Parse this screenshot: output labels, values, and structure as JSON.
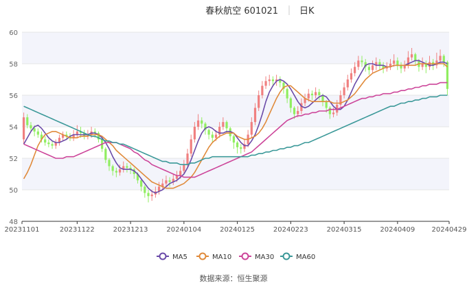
{
  "header": {
    "stock": "春秋航空 601021",
    "period": "日K"
  },
  "source": "数据来源：恒生聚源",
  "colors": {
    "up": "#f08080",
    "down": "#90ee60",
    "ma5": "#6a4aa8",
    "ma10": "#e08a3a",
    "ma30": "#cc4499",
    "ma60": "#3a9898",
    "grid": "#e6e6e6",
    "band": "#f3f4fb"
  },
  "chart_data": {
    "type": "candlestick",
    "ylim": [
      48,
      60
    ],
    "yticks": [
      "60",
      "58",
      "56",
      "54",
      "52",
      "50",
      "48"
    ],
    "xtick_labels": [
      "20231101",
      "20231122",
      "20231213",
      "20240104",
      "20240125",
      "20240223",
      "20240315",
      "20240409",
      "20240429"
    ],
    "xtick_index": [
      0,
      15,
      30,
      45,
      60,
      75,
      90,
      105,
      119
    ],
    "legend": [
      "MA5",
      "MA10",
      "MA30",
      "MA60"
    ],
    "candles": [
      [
        53.2,
        54.6,
        54.9,
        52.9
      ],
      [
        54.6,
        54.1,
        54.8,
        53.9
      ],
      [
        54.1,
        53.9,
        54.3,
        53.7
      ],
      [
        53.9,
        53.7,
        54.1,
        53.4
      ],
      [
        53.7,
        53.5,
        53.9,
        53.3
      ],
      [
        53.5,
        53.2,
        53.7,
        53.0
      ],
      [
        53.2,
        53.0,
        53.4,
        52.8
      ],
      [
        53.0,
        52.9,
        53.2,
        52.7
      ],
      [
        52.9,
        52.8,
        53.1,
        52.6
      ],
      [
        52.8,
        53.0,
        53.2,
        52.6
      ],
      [
        53.0,
        53.3,
        53.5,
        52.8
      ],
      [
        53.3,
        53.5,
        53.7,
        53.1
      ],
      [
        53.5,
        53.4,
        53.7,
        53.2
      ],
      [
        53.4,
        53.3,
        53.6,
        53.1
      ],
      [
        53.3,
        53.5,
        53.8,
        53.1
      ],
      [
        53.5,
        53.7,
        54.1,
        53.3
      ],
      [
        53.7,
        53.6,
        54.0,
        53.3
      ],
      [
        53.6,
        53.4,
        53.8,
        53.2
      ],
      [
        53.4,
        53.5,
        53.8,
        53.2
      ],
      [
        53.5,
        53.7,
        54.0,
        53.3
      ],
      [
        53.7,
        53.6,
        53.9,
        53.3
      ],
      [
        53.6,
        53.2,
        53.7,
        53.0
      ],
      [
        53.2,
        52.6,
        53.3,
        52.4
      ],
      [
        52.6,
        51.9,
        52.7,
        51.7
      ],
      [
        51.9,
        51.5,
        52.0,
        51.2
      ],
      [
        51.5,
        51.2,
        51.6,
        50.9
      ],
      [
        51.2,
        51.1,
        51.4,
        50.8
      ],
      [
        51.1,
        51.3,
        51.6,
        50.9
      ],
      [
        51.3,
        51.5,
        51.8,
        51.1
      ],
      [
        51.5,
        51.4,
        51.7,
        51.1
      ],
      [
        51.4,
        51.3,
        51.6,
        51.0
      ],
      [
        51.3,
        51.0,
        51.4,
        50.7
      ],
      [
        51.0,
        50.6,
        51.1,
        50.4
      ],
      [
        50.6,
        50.2,
        50.7,
        49.9
      ],
      [
        50.2,
        49.8,
        50.3,
        49.5
      ],
      [
        49.8,
        49.6,
        50.0,
        49.2
      ],
      [
        49.6,
        49.7,
        50.0,
        49.3
      ],
      [
        49.7,
        49.9,
        50.2,
        49.5
      ],
      [
        49.9,
        50.2,
        50.5,
        49.7
      ],
      [
        50.2,
        50.4,
        50.7,
        50.0
      ],
      [
        50.4,
        50.6,
        50.9,
        50.2
      ],
      [
        50.6,
        50.5,
        50.8,
        50.2
      ],
      [
        50.5,
        50.7,
        51.0,
        50.3
      ],
      [
        50.7,
        50.9,
        51.2,
        50.5
      ],
      [
        50.9,
        51.2,
        51.5,
        50.7
      ],
      [
        51.2,
        51.6,
        51.9,
        51.0
      ],
      [
        51.6,
        52.3,
        52.6,
        51.4
      ],
      [
        52.3,
        53.2,
        53.5,
        52.1
      ],
      [
        53.2,
        54.0,
        54.3,
        53.0
      ],
      [
        54.0,
        54.4,
        54.8,
        53.8
      ],
      [
        54.4,
        54.2,
        54.6,
        53.9
      ],
      [
        54.2,
        53.8,
        54.3,
        53.5
      ],
      [
        53.8,
        53.5,
        53.9,
        53.2
      ],
      [
        53.5,
        53.3,
        53.7,
        53.0
      ],
      [
        53.3,
        53.5,
        53.8,
        53.1
      ],
      [
        53.5,
        54.0,
        54.3,
        53.3
      ],
      [
        54.0,
        54.3,
        54.6,
        53.8
      ],
      [
        54.3,
        53.9,
        54.4,
        53.6
      ],
      [
        53.9,
        53.4,
        54.0,
        53.1
      ],
      [
        53.4,
        53.0,
        53.5,
        52.6
      ],
      [
        53.0,
        52.7,
        53.1,
        52.3
      ],
      [
        52.7,
        52.6,
        52.9,
        52.3
      ],
      [
        52.6,
        52.9,
        53.2,
        52.4
      ],
      [
        52.9,
        53.5,
        53.8,
        52.7
      ],
      [
        53.5,
        54.3,
        54.6,
        53.3
      ],
      [
        54.3,
        55.2,
        55.5,
        54.1
      ],
      [
        55.2,
        56.0,
        56.3,
        55.0
      ],
      [
        56.0,
        56.6,
        56.9,
        55.8
      ],
      [
        56.6,
        56.9,
        57.2,
        56.4
      ],
      [
        56.9,
        57.0,
        57.3,
        56.6
      ],
      [
        57.0,
        56.9,
        57.2,
        56.6
      ],
      [
        56.9,
        57.0,
        57.3,
        56.6
      ],
      [
        57.0,
        56.8,
        57.2,
        56.5
      ],
      [
        56.8,
        56.4,
        56.9,
        56.1
      ],
      [
        56.4,
        55.8,
        56.5,
        55.5
      ],
      [
        55.8,
        55.2,
        55.9,
        54.9
      ],
      [
        55.2,
        54.8,
        55.3,
        54.5
      ],
      [
        54.8,
        55.0,
        55.3,
        54.6
      ],
      [
        55.0,
        55.5,
        55.8,
        54.8
      ],
      [
        55.5,
        55.8,
        56.1,
        55.3
      ],
      [
        55.8,
        56.1,
        56.4,
        55.6
      ],
      [
        56.1,
        56.0,
        56.3,
        55.7
      ],
      [
        56.0,
        56.2,
        56.5,
        55.8
      ],
      [
        56.2,
        56.0,
        56.4,
        55.7
      ],
      [
        56.0,
        55.6,
        56.1,
        55.3
      ],
      [
        55.6,
        55.2,
        55.7,
        54.9
      ],
      [
        55.2,
        54.8,
        55.3,
        54.5
      ],
      [
        54.8,
        54.9,
        55.2,
        54.6
      ],
      [
        54.9,
        55.4,
        55.7,
        54.7
      ],
      [
        55.4,
        56.0,
        56.3,
        55.2
      ],
      [
        56.0,
        56.5,
        56.8,
        55.8
      ],
      [
        56.5,
        57.0,
        57.3,
        56.3
      ],
      [
        57.0,
        57.4,
        57.7,
        56.8
      ],
      [
        57.4,
        57.8,
        58.1,
        57.2
      ],
      [
        57.8,
        58.2,
        58.5,
        57.6
      ],
      [
        58.2,
        58.1,
        58.5,
        57.8
      ],
      [
        58.1,
        57.8,
        58.3,
        57.5
      ],
      [
        57.8,
        57.6,
        58.0,
        57.3
      ],
      [
        57.6,
        57.9,
        58.2,
        57.4
      ],
      [
        57.9,
        58.1,
        58.4,
        57.6
      ],
      [
        58.1,
        57.9,
        58.3,
        57.6
      ],
      [
        57.9,
        57.7,
        58.1,
        57.4
      ],
      [
        57.7,
        57.8,
        58.1,
        57.5
      ],
      [
        57.8,
        58.0,
        58.3,
        57.6
      ],
      [
        58.0,
        58.2,
        58.6,
        57.8
      ],
      [
        58.2,
        57.9,
        58.4,
        57.6
      ],
      [
        57.9,
        57.7,
        58.1,
        57.4
      ],
      [
        57.7,
        57.9,
        58.2,
        57.5
      ],
      [
        57.9,
        58.4,
        58.8,
        57.7
      ],
      [
        58.4,
        58.6,
        59.0,
        58.2
      ],
      [
        58.6,
        58.2,
        58.7,
        57.9
      ],
      [
        58.2,
        57.8,
        58.3,
        57.5
      ],
      [
        57.8,
        58.0,
        58.4,
        57.6
      ],
      [
        58.0,
        57.8,
        58.2,
        57.4
      ],
      [
        57.8,
        58.1,
        58.5,
        57.6
      ],
      [
        58.1,
        57.9,
        58.3,
        57.6
      ],
      [
        57.9,
        58.2,
        58.7,
        57.7
      ],
      [
        58.2,
        58.5,
        58.9,
        58.0
      ],
      [
        58.5,
        58.1,
        58.6,
        57.8
      ],
      [
        58.1,
        56.4,
        58.2,
        56.0
      ]
    ],
    "series": [
      {
        "name": "MA5",
        "values": [
          52.9,
          53.3,
          53.7,
          54.0,
          54.1,
          53.9,
          53.6,
          53.3,
          53.1,
          53.0,
          53.0,
          53.1,
          53.2,
          53.4,
          53.5,
          53.5,
          53.5,
          53.5,
          53.5,
          53.6,
          53.6,
          53.5,
          53.3,
          53.0,
          52.6,
          52.1,
          51.7,
          51.4,
          51.3,
          51.3,
          51.3,
          51.2,
          51.0,
          50.7,
          50.4,
          50.1,
          49.9,
          49.8,
          49.9,
          50.0,
          50.2,
          50.4,
          50.5,
          50.6,
          50.8,
          51.0,
          51.4,
          51.9,
          52.5,
          53.1,
          53.6,
          53.9,
          54.0,
          53.9,
          53.7,
          53.6,
          53.6,
          53.7,
          53.7,
          53.6,
          53.3,
          53.0,
          52.8,
          52.8,
          53.1,
          53.5,
          54.1,
          54.8,
          55.6,
          56.2,
          56.6,
          56.9,
          57.0,
          56.9,
          56.7,
          56.4,
          56.0,
          55.6,
          55.3,
          55.2,
          55.3,
          55.5,
          55.7,
          55.9,
          56.0,
          55.9,
          55.6,
          55.3,
          55.1,
          55.1,
          55.3,
          55.7,
          56.2,
          56.7,
          57.1,
          57.5,
          57.9,
          58.0,
          58.0,
          57.9,
          57.9,
          57.9,
          57.8,
          57.8,
          57.9,
          57.9,
          57.9,
          57.9,
          58.0,
          58.1,
          58.2,
          58.2,
          58.1,
          58.0,
          57.9,
          57.9,
          58.0,
          58.1,
          58.1,
          58.0
        ]
      },
      {
        "name": "MA10",
        "values": [
          50.7,
          51.1,
          51.6,
          52.2,
          52.8,
          53.2,
          53.5,
          53.6,
          53.7,
          53.7,
          53.6,
          53.5,
          53.4,
          53.3,
          53.3,
          53.3,
          53.4,
          53.4,
          53.4,
          53.5,
          53.5,
          53.5,
          53.4,
          53.2,
          53.0,
          52.8,
          52.5,
          52.3,
          52.1,
          51.9,
          51.7,
          51.5,
          51.3,
          51.1,
          50.9,
          50.7,
          50.5,
          50.4,
          50.3,
          50.2,
          50.1,
          50.1,
          50.1,
          50.2,
          50.3,
          50.4,
          50.6,
          50.8,
          51.1,
          51.5,
          51.9,
          52.3,
          52.7,
          53.0,
          53.2,
          53.4,
          53.5,
          53.6,
          53.6,
          53.6,
          53.4,
          53.3,
          53.2,
          53.2,
          53.3,
          53.4,
          53.6,
          53.9,
          54.3,
          54.8,
          55.3,
          55.8,
          56.2,
          56.5,
          56.6,
          56.6,
          56.4,
          56.2,
          56.0,
          55.8,
          55.7,
          55.6,
          55.6,
          55.6,
          55.6,
          55.6,
          55.6,
          55.5,
          55.5,
          55.5,
          55.6,
          55.7,
          55.9,
          56.1,
          56.4,
          56.7,
          57.0,
          57.2,
          57.4,
          57.5,
          57.6,
          57.7,
          57.8,
          57.8,
          57.9,
          57.9,
          57.9,
          57.9,
          57.9,
          57.9,
          57.9,
          58.0,
          58.0,
          58.0,
          58.0,
          58.0,
          58.0,
          58.0,
          58.0,
          57.8
        ]
      },
      {
        "name": "MA30",
        "values": [
          52.9,
          52.8,
          52.7,
          52.6,
          52.5,
          52.4,
          52.3,
          52.2,
          52.1,
          52.0,
          52.0,
          52.0,
          52.1,
          52.1,
          52.1,
          52.2,
          52.3,
          52.4,
          52.5,
          52.6,
          52.7,
          52.8,
          52.9,
          53.0,
          53.0,
          53.0,
          53.0,
          52.9,
          52.8,
          52.7,
          52.6,
          52.4,
          52.3,
          52.1,
          51.9,
          51.8,
          51.6,
          51.5,
          51.4,
          51.3,
          51.2,
          51.1,
          51.0,
          50.9,
          50.9,
          50.8,
          50.8,
          50.8,
          50.8,
          50.9,
          51.0,
          51.1,
          51.2,
          51.3,
          51.4,
          51.5,
          51.6,
          51.7,
          51.8,
          51.9,
          52.0,
          52.1,
          52.2,
          52.3,
          52.4,
          52.6,
          52.8,
          53.0,
          53.2,
          53.4,
          53.6,
          53.8,
          54.0,
          54.2,
          54.4,
          54.5,
          54.6,
          54.7,
          54.7,
          54.8,
          54.8,
          54.9,
          54.9,
          55.0,
          55.0,
          55.0,
          55.1,
          55.1,
          55.1,
          55.2,
          55.3,
          55.4,
          55.5,
          55.6,
          55.7,
          55.8,
          55.8,
          55.9,
          55.9,
          56.0,
          56.0,
          56.1,
          56.1,
          56.1,
          56.2,
          56.2,
          56.3,
          56.3,
          56.4,
          56.4,
          56.5,
          56.5,
          56.6,
          56.6,
          56.7,
          56.7,
          56.7,
          56.8,
          56.8,
          56.8
        ]
      },
      {
        "name": "MA60",
        "values": [
          55.3,
          55.2,
          55.1,
          55.0,
          54.9,
          54.8,
          54.7,
          54.6,
          54.5,
          54.4,
          54.3,
          54.2,
          54.1,
          54.0,
          53.9,
          53.8,
          53.7,
          53.6,
          53.5,
          53.4,
          53.4,
          53.3,
          53.2,
          53.1,
          53.1,
          53.0,
          53.0,
          52.9,
          52.9,
          52.8,
          52.7,
          52.6,
          52.5,
          52.4,
          52.3,
          52.2,
          52.1,
          52.0,
          51.9,
          51.8,
          51.8,
          51.7,
          51.7,
          51.7,
          51.6,
          51.6,
          51.6,
          51.7,
          51.7,
          51.8,
          51.9,
          52.0,
          52.0,
          52.1,
          52.1,
          52.1,
          52.1,
          52.1,
          52.1,
          52.1,
          52.1,
          52.1,
          52.1,
          52.1,
          52.2,
          52.2,
          52.3,
          52.3,
          52.4,
          52.4,
          52.5,
          52.5,
          52.6,
          52.6,
          52.7,
          52.7,
          52.8,
          52.8,
          52.9,
          53.0,
          53.0,
          53.1,
          53.2,
          53.3,
          53.4,
          53.5,
          53.6,
          53.7,
          53.8,
          53.9,
          54.0,
          54.1,
          54.2,
          54.3,
          54.4,
          54.5,
          54.6,
          54.7,
          54.8,
          54.9,
          55.0,
          55.1,
          55.2,
          55.3,
          55.3,
          55.4,
          55.5,
          55.5,
          55.6,
          55.6,
          55.7,
          55.7,
          55.8,
          55.8,
          55.9,
          55.9,
          55.9,
          56.0,
          56.0,
          56.0
        ]
      }
    ]
  }
}
